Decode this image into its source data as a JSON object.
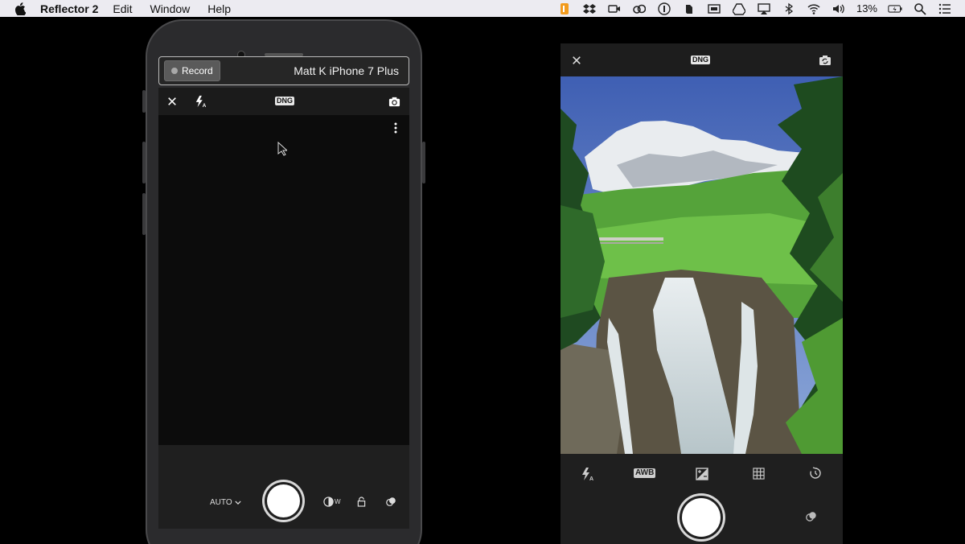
{
  "menubar": {
    "app_name": "Reflector 2",
    "menus": [
      "Edit",
      "Window",
      "Help"
    ],
    "battery_percent": "13%",
    "status_icons": [
      "lastpass-icon",
      "dropbox-icon",
      "facetime-icon",
      "creative-cloud-icon",
      "istat-icon",
      "evernote-icon",
      "screen-icon",
      "drive-icon",
      "airplay-icon",
      "bluetooth-icon",
      "wifi-icon",
      "volume-icon",
      "battery-icon",
      "spotlight-icon",
      "notification-center-icon"
    ]
  },
  "recorder": {
    "record_label": "Record",
    "device_name": "Matt K iPhone 7 Plus"
  },
  "camera_left": {
    "format_badge": "DNG",
    "mode_label": "AUTO",
    "wb_suffix": "W"
  },
  "camera_right": {
    "format_badge": "DNG",
    "awb_label": "AWB"
  },
  "colors": {
    "menubar_bg": "#ecebf1",
    "screen_bg": "#0c0c0c",
    "panel_bg": "#1f1f1f"
  }
}
